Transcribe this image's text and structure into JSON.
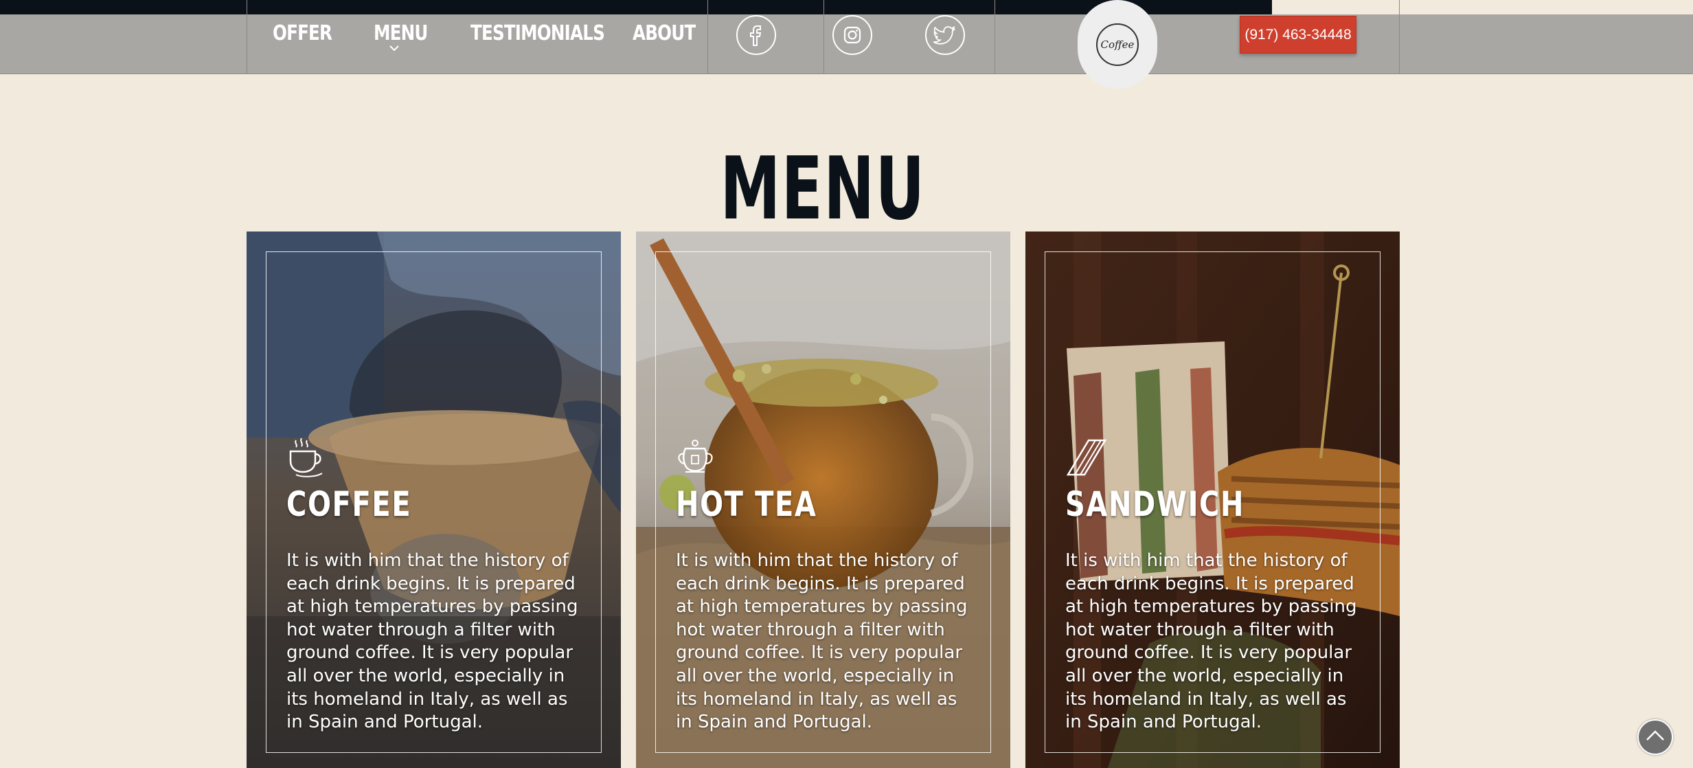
{
  "nav": {
    "links": [
      "OFFER",
      "MENU",
      "TESTIMONIALS",
      "ABOUT"
    ],
    "active": "MENU",
    "social_icons": [
      "facebook-icon",
      "instagram-icon",
      "twitter-icon"
    ],
    "logo_text": "Coffee",
    "phone_label": "(917) 463-34448"
  },
  "section": {
    "title": "MENU"
  },
  "cards": [
    {
      "icon": "coffee-cup-icon",
      "title": "COFFEE",
      "text": "It is with him that the history of each drink begins. It is prepared at high temperatures by passing hot water through a filter with ground coffee. It is very popular all over the world, especially in its homeland in Italy, as well as in Spain and Portugal."
    },
    {
      "icon": "teapot-icon",
      "title": "HOT TEA",
      "text": "It is with him that the history of each drink begins. It is prepared at high temperatures by passing hot water through a filter with ground coffee. It is very popular all over the world, especially in its homeland in Italy, as well as in Spain and Portugal."
    },
    {
      "icon": "sandwich-icon",
      "title": "SANDWICH",
      "text": "It is with him that the history of each drink begins. It is prepared at high temperatures by passing hot water through a filter with ground coffee. It is very popular all over the world, especially in its homeland in Italy, as well as in Spain and Portugal."
    }
  ],
  "colors": {
    "dark": "#0b1119",
    "nav_bg": "#a9a7a4",
    "page_bg": "#f2ebdd",
    "accent": "#cf3f2d"
  }
}
